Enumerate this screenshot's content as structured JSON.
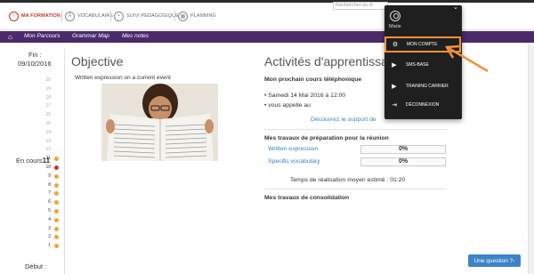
{
  "topnav": {
    "items": [
      {
        "label": "MA FORMATION",
        "icon": "person-up-icon"
      },
      {
        "label": "VOCABULAIRE",
        "icon": "az-icon"
      },
      {
        "label": "SUIVI PÉDAGOGIQUE",
        "icon": "chart-icon"
      },
      {
        "label": "PLANNING",
        "icon": "grid-icon"
      }
    ]
  },
  "subnav": {
    "links": [
      "Mon Parcours",
      "Grammar Map",
      "Mes notes"
    ],
    "search_placeholder": "Rechercher un m"
  },
  "timeline": {
    "fin_label": "Fin :",
    "fin_date": "09/10/2016",
    "current_label": "En cours",
    "current_value": "11",
    "debut_label": "Début :",
    "rows": [
      {
        "num": "20",
        "dot": ""
      },
      {
        "num": "19",
        "dot": ""
      },
      {
        "num": "18",
        "dot": ""
      },
      {
        "num": "17",
        "dot": ""
      },
      {
        "num": "16",
        "dot": ""
      },
      {
        "num": "15",
        "dot": ""
      },
      {
        "num": "14",
        "dot": ""
      },
      {
        "num": "13",
        "dot": ""
      },
      {
        "num": "12",
        "dot": ""
      },
      {
        "num": "11",
        "dot": "#f0a43a"
      },
      {
        "num": "10",
        "dot": "#c0392b"
      },
      {
        "num": "9",
        "dot": "#f0a43a"
      },
      {
        "num": "8",
        "dot": "#f0a43a"
      },
      {
        "num": "7",
        "dot": "#f0a43a"
      },
      {
        "num": "6",
        "dot": "#f0a43a"
      },
      {
        "num": "5",
        "dot": "#f0a43a"
      },
      {
        "num": "4",
        "dot": "#f0a43a"
      },
      {
        "num": "3",
        "dot": "#f0a43a"
      },
      {
        "num": "2",
        "dot": "#f0a43a"
      },
      {
        "num": "1",
        "dot": "#f0a43a"
      }
    ]
  },
  "objective": {
    "title": "Objective",
    "text": "Written expression on a current event"
  },
  "activities": {
    "title": "Activités d'apprentissage",
    "next_call_heading": "Mon prochain cours téléphonique",
    "next_call_date": "• Samedi 14 Mai 2016 à 12:00",
    "next_call_note": "• vous appelle au",
    "support_link": "Découvrez le support de",
    "prep_heading": "Mes travaux de préparation pour la réunion",
    "prep_items": [
      {
        "label": "Written expression",
        "value": "0%"
      },
      {
        "label": "Specific vocabulary",
        "value": "0%"
      }
    ],
    "time_text": "Temps de réalisation moyen estimé : 01:20",
    "consolidation_heading": "Mes travaux de consolidation"
  },
  "dropdown": {
    "user_name": "Marie",
    "items": [
      {
        "label": "MON COMPTE",
        "icon": "gear-icon"
      },
      {
        "label": "SMS-BASE",
        "icon": "play-icon"
      },
      {
        "label": "TRAINING CARRIER",
        "icon": "play-icon"
      },
      {
        "label": "DÉCONNEXION",
        "icon": "logout-icon"
      }
    ]
  },
  "question_button": "Une question ?-",
  "colors": {
    "purple": "#4b2a6b",
    "accent_orange": "#f39237",
    "link_blue": "#3a7fc1",
    "active_red": "#c0392b"
  }
}
